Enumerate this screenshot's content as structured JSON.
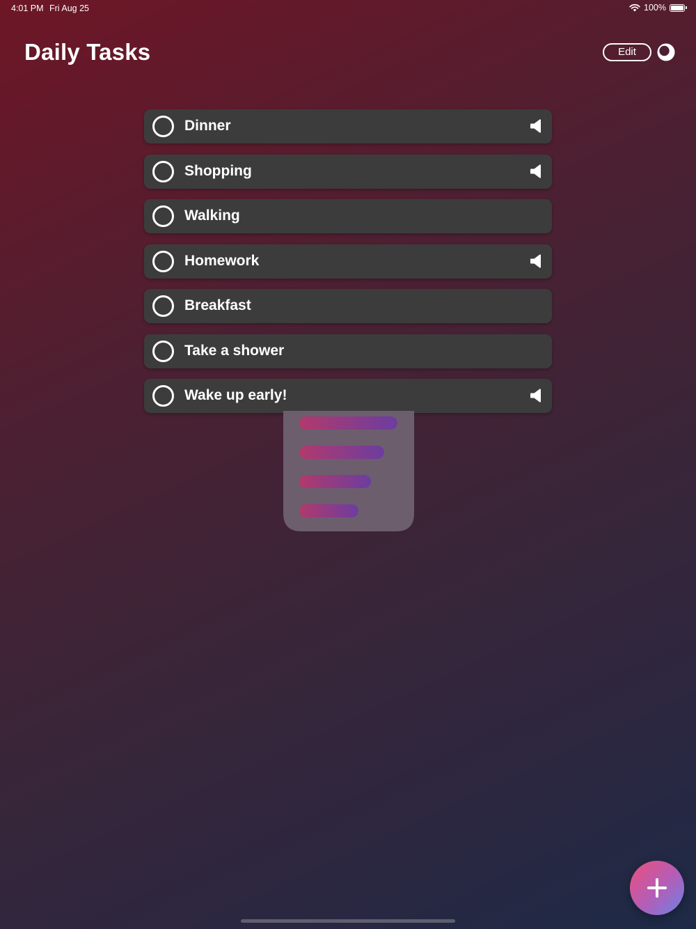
{
  "status_bar": {
    "time": "4:01 PM",
    "date": "Fri Aug 25",
    "battery_text": "100%",
    "battery_level": 1.0,
    "wifi_icon": "wifi-icon"
  },
  "header": {
    "title": "Daily Tasks",
    "edit_label": "Edit",
    "theme_icon": "moon-icon"
  },
  "tasks": [
    {
      "label": "Dinner",
      "completed": false,
      "has_sound": true
    },
    {
      "label": "Shopping",
      "completed": false,
      "has_sound": true
    },
    {
      "label": "Walking",
      "completed": false,
      "has_sound": false
    },
    {
      "label": "Homework",
      "completed": false,
      "has_sound": true
    },
    {
      "label": "Breakfast",
      "completed": false,
      "has_sound": false
    },
    {
      "label": "Take a shower",
      "completed": false,
      "has_sound": false
    },
    {
      "label": "Wake up early!",
      "completed": false,
      "has_sound": true
    }
  ],
  "fab": {
    "icon": "plus-icon"
  },
  "colors": {
    "task_background": "#3c3c3c",
    "fab_gradient_start": "#ee4f7a",
    "fab_gradient_end": "#6a83e6",
    "background_top": "#6e1626",
    "background_bottom": "#1d2a47"
  }
}
